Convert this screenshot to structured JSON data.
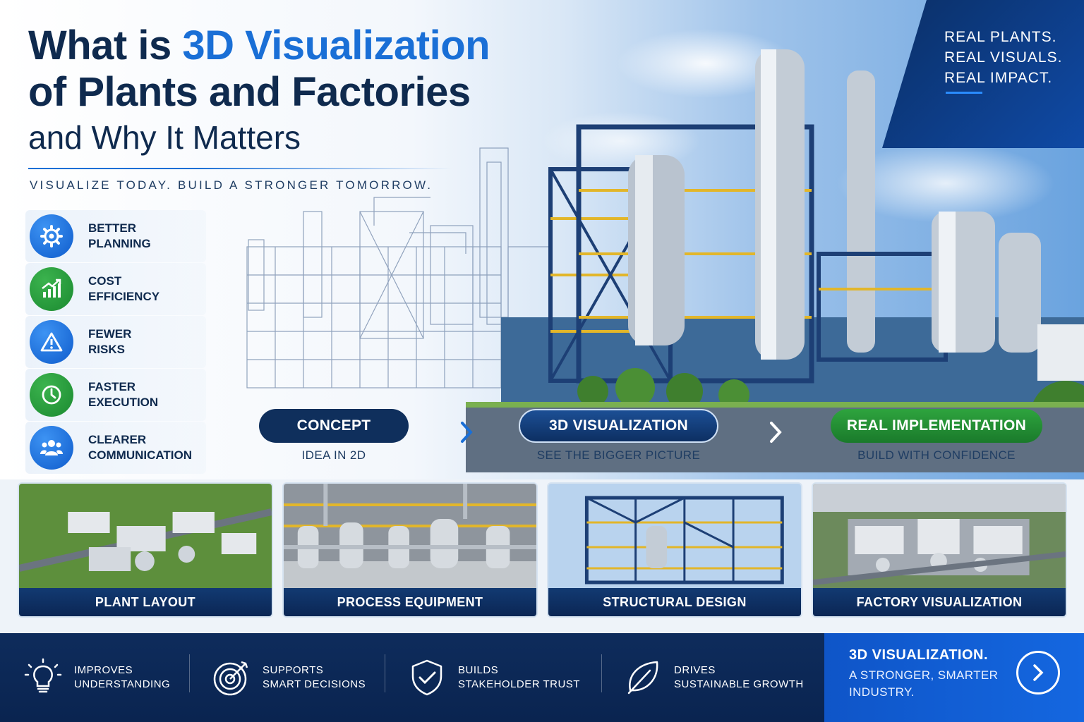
{
  "title": {
    "line1_prefix": "What is ",
    "line1_highlight": "3D Visualization",
    "line2": "of Plants and Factories",
    "line3": "and Why It Matters",
    "tagline": "VISUALIZE TODAY. BUILD A STRONGER TOMORROW."
  },
  "corner_banner": {
    "line1": "REAL PLANTS.",
    "line2": "REAL VISUALS.",
    "line3": "REAL IMPACT."
  },
  "benefits": [
    {
      "line1": "BETTER",
      "line2": "PLANNING",
      "icon": "gear-icon",
      "color": "#1a6fd6"
    },
    {
      "line1": "COST",
      "line2": "EFFICIENCY",
      "icon": "growth-chart-icon",
      "color": "#24993a"
    },
    {
      "line1": "FEWER",
      "line2": "RISKS",
      "icon": "warning-icon",
      "color": "#1a6fd6"
    },
    {
      "line1": "FASTER",
      "line2": "EXECUTION",
      "icon": "clock-icon",
      "color": "#24993a"
    },
    {
      "line1": "CLEARER",
      "line2": "COMMUNICATION",
      "icon": "people-icon",
      "color": "#1a6fd6"
    }
  ],
  "process": {
    "steps": [
      {
        "label": "CONCEPT",
        "sub": "IDEA IN 2D"
      },
      {
        "label": "3D VISUALIZATION",
        "sub": "SEE THE BIGGER PICTURE"
      },
      {
        "label": "REAL IMPLEMENTATION",
        "sub": "BUILD WITH CONFIDENCE"
      }
    ]
  },
  "cards": [
    {
      "label": "PLANT LAYOUT"
    },
    {
      "label": "PROCESS EQUIPMENT"
    },
    {
      "label": "STRUCTURAL DESIGN"
    },
    {
      "label": "FACTORY VISUALIZATION"
    }
  ],
  "footer": {
    "items": [
      {
        "line1": "IMPROVES",
        "line2": "UNDERSTANDING",
        "icon": "lightbulb-icon"
      },
      {
        "line1": "SUPPORTS",
        "line2": "SMART DECISIONS",
        "icon": "target-icon"
      },
      {
        "line1": "BUILDS",
        "line2": "STAKEHOLDER TRUST",
        "icon": "shield-check-icon"
      },
      {
        "line1": "DRIVES",
        "line2": "SUSTAINABLE GROWTH",
        "icon": "leaf-icon"
      }
    ],
    "cta": {
      "title": "3D VISUALIZATION.",
      "subtitle": "A STRONGER, SMARTER INDUSTRY.",
      "icon": "chevron-right-icon"
    }
  },
  "colors": {
    "navy": "#0f2a4e",
    "accent_blue": "#1a6fd6",
    "accent_green": "#24993a"
  }
}
